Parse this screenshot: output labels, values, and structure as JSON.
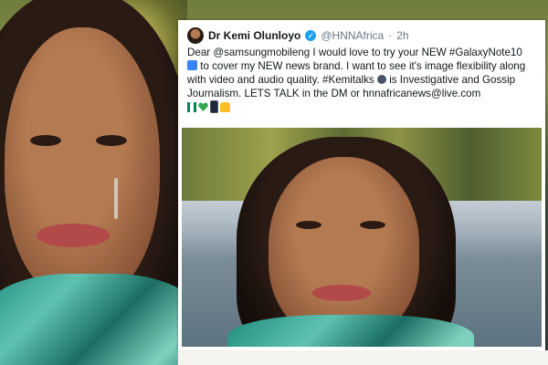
{
  "tweet": {
    "name": "Dr Kemi Olunloyo",
    "handle": "@HNNAfrica",
    "separator": "·",
    "time": "2h",
    "text_line1": "Dear @samsungmobileng I would love to try your NEW #GalaxyNote10",
    "text_line2_a": "to cover my NEW news brand. I want to see it's image flexibility along",
    "text_line3": "with video and audio quality. #Kemitalks",
    "text_line3_b": "is Investigative and Gossip",
    "text_line4": "Journalism. LETS TALK in the DM or hnnafricanews@live.com",
    "emojis": [
      "nigeria-flag-icon",
      "green-heart-icon",
      "mobile-phone-icon",
      "thumbs-up-icon"
    ]
  },
  "colors": {
    "verified": "#1da1f2",
    "text": "#14171a",
    "muted": "#657786"
  }
}
